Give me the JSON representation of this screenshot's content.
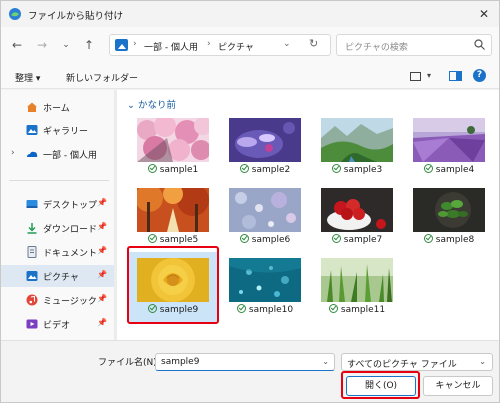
{
  "window": {
    "title": "ファイルから貼り付け",
    "close_icon": "close-icon"
  },
  "navbar": {
    "breadcrumbs": [
      "一部 - 個人用",
      "ピクチャ"
    ],
    "search_placeholder": "ピクチャの検索"
  },
  "cmdbar": {
    "organize": "整理 ▾",
    "new_folder": "新しいフォルダー"
  },
  "sidebar": {
    "items": [
      {
        "label": "ホーム",
        "icon": "home-icon",
        "color": "#e8822a"
      },
      {
        "label": "ギャラリー",
        "icon": "gallery-icon",
        "color": "#1a73c9"
      },
      {
        "label": "一部 - 個人用",
        "icon": "onedrive-icon",
        "color": "#0a64c8"
      },
      {
        "label": "デスクトップ",
        "icon": "desktop-icon",
        "color": "#2b8be0"
      },
      {
        "label": "ダウンロード",
        "icon": "download-icon",
        "color": "#1f9d55"
      },
      {
        "label": "ドキュメント",
        "icon": "documents-icon",
        "color": "#6b7a8c"
      },
      {
        "label": "ピクチャ",
        "icon": "pictures-icon",
        "color": "#1a73c9"
      },
      {
        "label": "ミュージック",
        "icon": "music-icon",
        "color": "#e0463a"
      },
      {
        "label": "ビデオ",
        "icon": "videos-icon",
        "color": "#7a3fc0"
      }
    ]
  },
  "content": {
    "group_header": "かなり前",
    "files": [
      {
        "name": "sample1",
        "theme": "cherry"
      },
      {
        "name": "sample2",
        "theme": "purple-flower"
      },
      {
        "name": "sample3",
        "theme": "valley"
      },
      {
        "name": "sample4",
        "theme": "lavender"
      },
      {
        "name": "sample5",
        "theme": "autumn"
      },
      {
        "name": "sample6",
        "theme": "bokeh"
      },
      {
        "name": "sample7",
        "theme": "strawberry"
      },
      {
        "name": "sample8",
        "theme": "basil"
      },
      {
        "name": "sample9",
        "theme": "rose",
        "selected": true
      },
      {
        "name": "sample10",
        "theme": "water"
      },
      {
        "name": "sample11",
        "theme": "grass"
      }
    ]
  },
  "bottom": {
    "filename_label": "ファイル名(N):",
    "filename_value": "sample9",
    "filetype_value": "すべてのピクチャ ファイル",
    "open_label": "開く(O)",
    "cancel_label": "キャンセル"
  },
  "colors": {
    "accent": "#1a73c9",
    "highlight": "#e60012",
    "selection": "#cce4f7"
  }
}
